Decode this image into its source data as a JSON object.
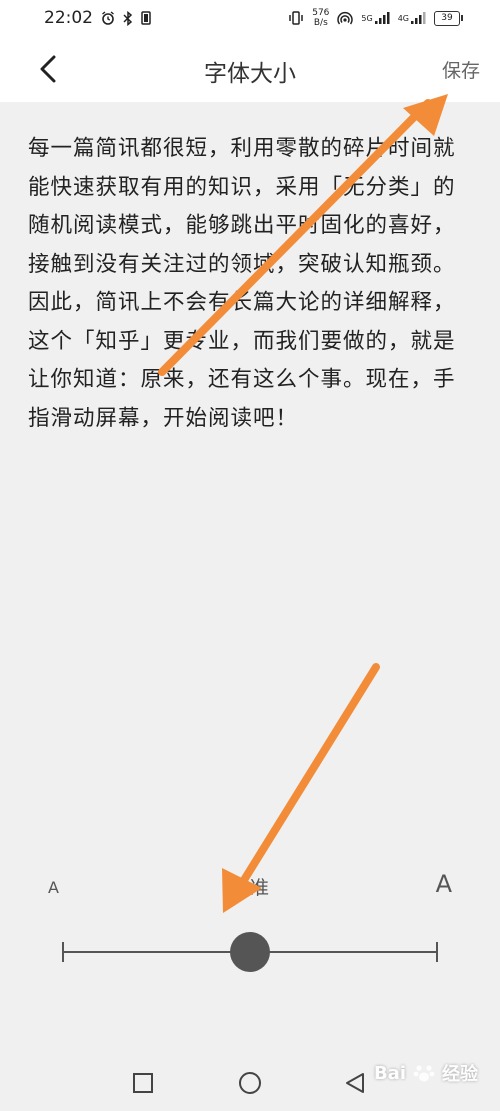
{
  "status_bar": {
    "time": "22:02",
    "net_speed_value": "576",
    "net_speed_unit": "B/s",
    "signal_1": "5G",
    "signal_2": "4G",
    "battery": "39"
  },
  "header": {
    "title": "字体大小",
    "save_label": "保存"
  },
  "preview": {
    "text": "每一篇简讯都很短，利用零散的碎片时间就能快速获取有用的知识，采用「无分类」的随机阅读模式，能够跳出平时固化的喜好，接触到没有关注过的领域，突破认知瓶颈。因此，简讯上不会有长篇大论的详细解释，这个「知乎」更专业，而我们要做的，就是让你知道：原来，还有这么个事。现在，手指滑动屏幕，开始阅读吧！"
  },
  "font_size": {
    "small_label": "A",
    "standard_label": "标准",
    "large_label": "A",
    "slider_value_fraction": 0.5
  },
  "bottom_nav": {
    "icons": [
      "square-icon",
      "circle-icon",
      "triangle-back-icon"
    ]
  },
  "watermark": {
    "brand": "Bai",
    "suffix": "经验"
  },
  "colors": {
    "background": "#f0f0f0",
    "header_bg": "#ffffff",
    "text": "#222222",
    "arrow": "#f28c38",
    "slider": "#555555"
  }
}
